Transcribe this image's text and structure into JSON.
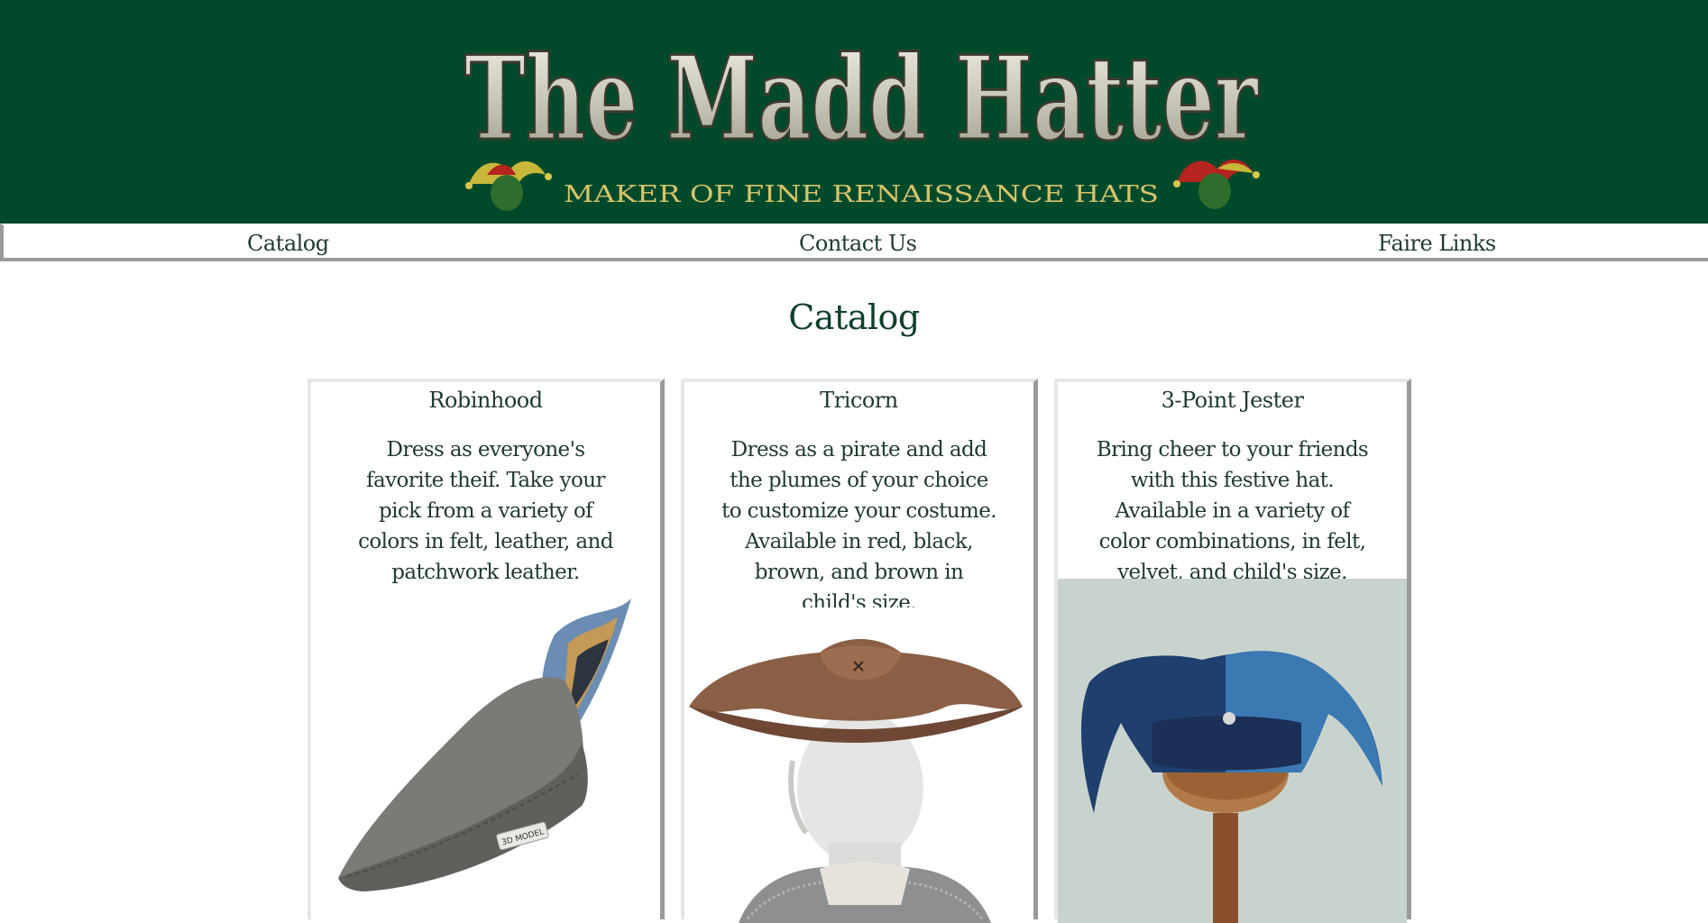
{
  "header": {
    "logo_title": "The Madd Hatter",
    "logo_tagline": "MAKER OF FINE RENAISSANCE HATS"
  },
  "nav": {
    "items": [
      {
        "label": "Catalog"
      },
      {
        "label": "Contact Us"
      },
      {
        "label": "Faire Links"
      }
    ]
  },
  "main": {
    "title": "Catalog",
    "cards": [
      {
        "title": "Robinhood",
        "description": "Dress as everyone's favorite theif. Take your pick from a variety of colors in felt, leather, and patchwork leather.",
        "image_badge": "3D MODEL"
      },
      {
        "title": "Tricorn",
        "description": "Dress as a pirate and add the plumes of your choice to customize your costume. Available in red, black, brown, and brown in child's size."
      },
      {
        "title": "3-Point Jester",
        "description": "Bring cheer to your friends with this festive hat. Available in a variety of color combinations, in felt, velvet, and child's size."
      }
    ]
  },
  "colors": {
    "banner_green": "#004a2c",
    "title_green": "#0d3f2a",
    "border_gray": "#9a9a9a"
  }
}
